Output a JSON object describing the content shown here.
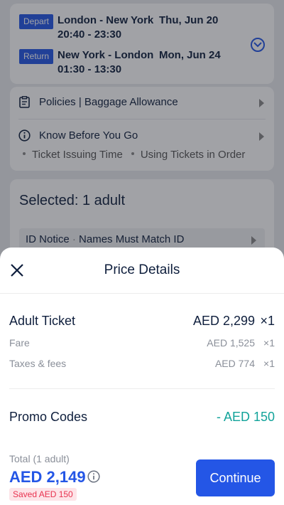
{
  "flights": [
    {
      "badge": "Depart",
      "route": "London - New York",
      "date": "Thu, Jun 20",
      "times": "20:40 - 23:30"
    },
    {
      "badge": "Return",
      "route": "New York - London",
      "date": "Mon, Jun 24",
      "times": "01:30 - 13:30"
    }
  ],
  "info": {
    "policies_label": "Policies | Baggage Allowance",
    "know_label": "Know Before You Go",
    "sub_items": [
      "Ticket Issuing Time",
      "Using Tickets in Order"
    ]
  },
  "selected": {
    "title": "Selected: 1 adult",
    "notice_label": "ID Notice",
    "notice_text": "Names Must Match ID"
  },
  "price_details": {
    "title": "Price Details",
    "adult_ticket": {
      "label": "Adult Ticket",
      "amount": "AED 2,299",
      "qty": "×1"
    },
    "fare": {
      "label": "Fare",
      "amount": "AED 1,525",
      "qty": "×1"
    },
    "taxes": {
      "label": "Taxes & fees",
      "amount": "AED 774",
      "qty": "×1"
    },
    "promo": {
      "label": "Promo Codes",
      "amount": "- AED 150"
    },
    "total_label": "Total (1 adult)",
    "total_amount": "AED 2,149",
    "saved": "Saved AED 150",
    "continue_label": "Continue"
  },
  "colors": {
    "accent": "#2456e6",
    "promo": "#12a39a",
    "saved_text": "#e8324f",
    "saved_bg": "#fde4e8"
  }
}
